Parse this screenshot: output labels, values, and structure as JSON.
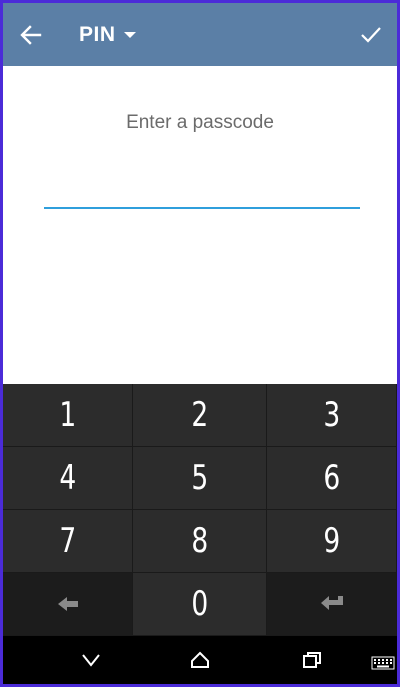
{
  "appbar": {
    "title": "PIN",
    "back_icon": "arrow-left-icon",
    "dropdown_icon": "caret-down-icon",
    "confirm_icon": "checkmark-icon",
    "background": "#5b7fa6"
  },
  "content": {
    "prompt": "Enter a passcode",
    "input_value": "",
    "accent": "#2f9fdc"
  },
  "keypad": {
    "keys": [
      "1",
      "2",
      "3",
      "4",
      "5",
      "6",
      "7",
      "8",
      "9",
      "0"
    ],
    "left_action_icon": "arrow-left-icon",
    "right_action_icon": "backspace-icon"
  },
  "navbar": {
    "icons": [
      "nav-back-icon",
      "home-icon",
      "recents-icon",
      "keyboard-icon"
    ]
  }
}
